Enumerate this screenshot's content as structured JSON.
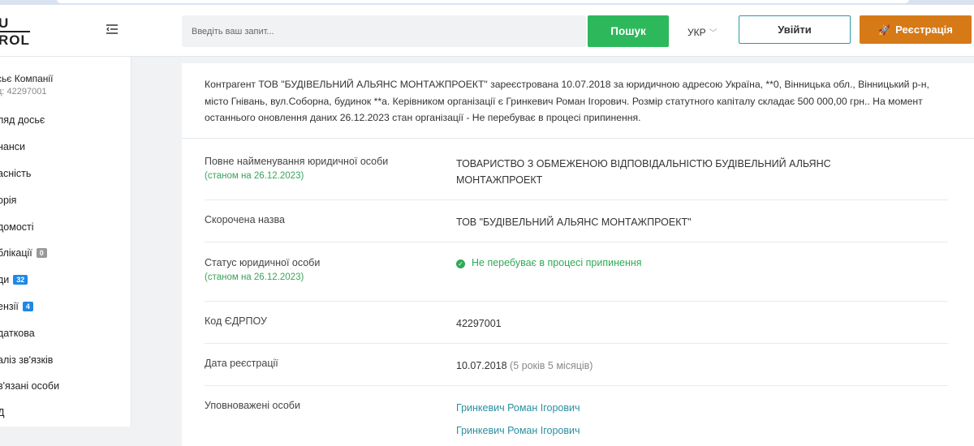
{
  "logo": {
    "line1": "U",
    "line2": "ROL"
  },
  "sidebar": {
    "title": "сьє Компанії",
    "subtitle": "д: 42297001",
    "items": [
      {
        "label": "ляд досьє"
      },
      {
        "label": "нанси"
      },
      {
        "label": "асність"
      },
      {
        "label": "орія"
      },
      {
        "label": "домості"
      },
      {
        "label": "блікації",
        "badge": "0"
      },
      {
        "label": "ди",
        "badge": "32"
      },
      {
        "label": "ензії",
        "badge": "4"
      },
      {
        "label": "даткова"
      },
      {
        "label": "аліз зв'язків"
      },
      {
        "label": "в'язані особи"
      },
      {
        "label": "Д"
      }
    ]
  },
  "header": {
    "search_placeholder": "Введіть ваш запит...",
    "search_button": "Пошук",
    "language": "УКР",
    "login_button": "Увійти",
    "register_button": "Реєстрація"
  },
  "summary": "Контрагент ТОВ \"БУДІВЕЛЬНИЙ АЛЬЯНС МОНТАЖПРОЕКТ\" зареєстрована 10.07.2018 за юридичною адресою Україна, **0, Вінницька обл., Вінницький р-н, місто Гнівань, вул.Соборна, будинок **а. Керівником організації є Гринкевич Роман Ігорович. Розмір статутного капіталу складає 500 000,00 грн.. На момент останнього оновлення даних 26.12.2023 стан організації - Не перебуває в процесі припинення.",
  "details": {
    "full_name": {
      "label": "Повне найменування юридичної особи",
      "as_of": "(станом на 26.12.2023)",
      "value": "ТОВАРИСТВО З ОБМЕЖЕНОЮ ВІДПОВІДАЛЬНІСТЮ БУДІВЕЛЬНИЙ АЛЬЯНС МОНТАЖПРОЕКТ"
    },
    "short_name": {
      "label": "Скорочена назва",
      "value": "ТОВ \"БУДІВЕЛЬНИЙ АЛЬЯНС МОНТАЖПРОЕКТ\""
    },
    "status": {
      "label": "Статус юридичної особи",
      "as_of": "(станом на 26.12.2023)",
      "value": "Не перебуває в процесі припинення"
    },
    "edrpou": {
      "label": "Код ЄДРПОУ",
      "value": "42297001"
    },
    "registration_date": {
      "label": "Дата реєстрації",
      "value": "10.07.2018",
      "duration": "(5 років 5 місяців)"
    },
    "authorized": {
      "label": "Уповноважені особи",
      "persons": [
        "Гринкевич Роман Ігорович",
        "Гринкевич Роман Ігорович"
      ]
    }
  },
  "colors": {
    "accent_green": "#2eb85c",
    "accent_orange": "#d67a17",
    "link_teal": "#2a8fa0"
  }
}
